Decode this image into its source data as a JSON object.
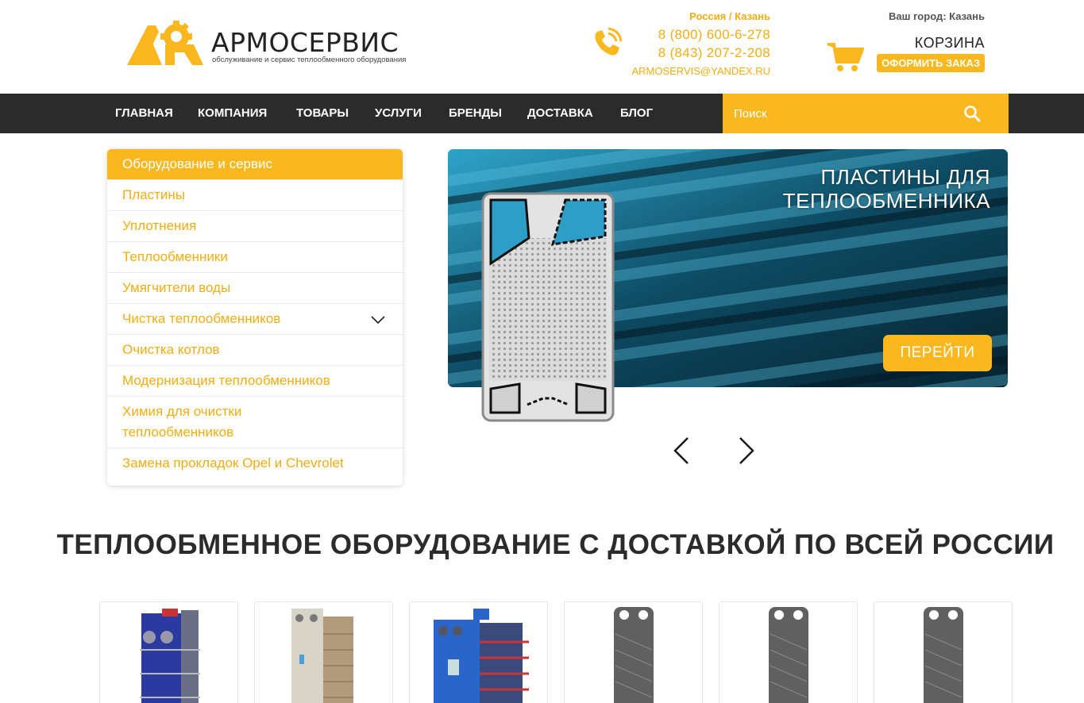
{
  "header": {
    "brand": "АРМОСЕРВИС",
    "tagline": "обслуживание и сервис теплообменного оборудования",
    "region": "Россия / Казань",
    "phones": [
      "8 (800) 600-6-278",
      "8 (843) 207-2-208"
    ],
    "email": "ARMOSERVIS@YANDEX.RU",
    "city": "Ваш город: Казань",
    "cart_label": "КОРЗИНА",
    "order_button": "ОФОРМИТЬ ЗАКАЗ"
  },
  "nav": {
    "items": [
      "ГЛАВНАЯ",
      "КОМПАНИЯ",
      "ТОВАРЫ",
      "УСЛУГИ",
      "БРЕНДЫ",
      "ДОСТАВКА",
      "БЛОГ"
    ],
    "search_placeholder": "Поиск"
  },
  "sidebar": {
    "heading": "Оборудование и сервис",
    "items": [
      "Пластины",
      "Уплотнения",
      "Теплообменники",
      "Умягчители воды",
      "Чистка теплообменников",
      "Очистка котлов",
      "Модернизация теплообменников",
      "Химия для очистки теплообменников",
      "Замена прокладок Opel и Chevrolet"
    ]
  },
  "banner": {
    "title_line1": "ПЛАСТИНЫ ДЛЯ",
    "title_line2": "ТЕПЛООБМЕННИКА",
    "button": "ПЕРЕЙТИ"
  },
  "section": {
    "title": "ТЕПЛООБМЕННОЕ ОБОРУДОВАНИЕ С ДОСТАВКОЙ ПО ВСЕЙ РОССИИ"
  },
  "products": [
    {
      "kind": "blue-heat-exchanger"
    },
    {
      "kind": "steel-heat-exchanger"
    },
    {
      "kind": "blue-heat-exchanger-wide"
    },
    {
      "kind": "plate"
    },
    {
      "kind": "plate"
    },
    {
      "kind": "plate"
    }
  ],
  "colors": {
    "accent": "#fbb81e",
    "accent_text": "#f2ad12",
    "nav_bg": "#2b2b2b"
  }
}
